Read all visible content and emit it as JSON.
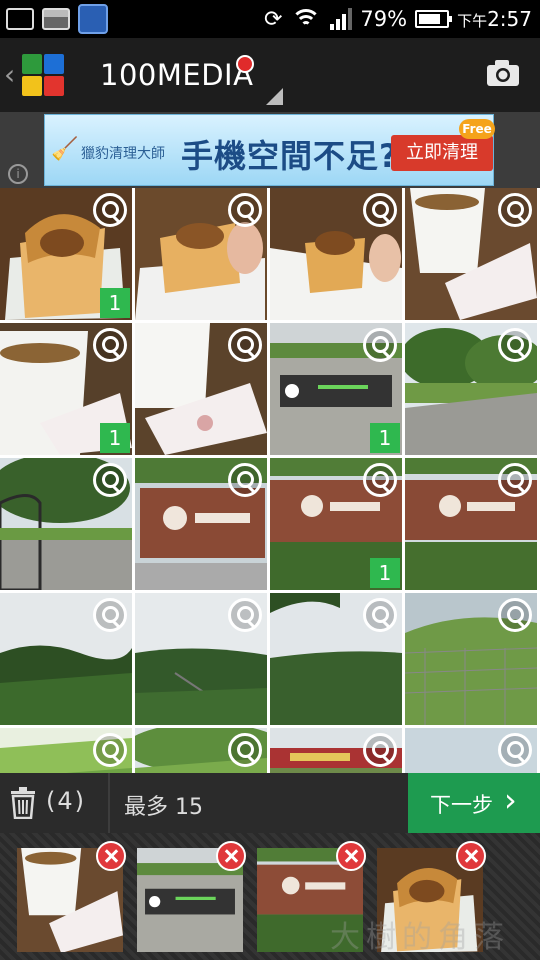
{
  "status_bar": {
    "battery": "79%",
    "time_prefix": "下午",
    "time": "2:57",
    "icons": [
      "edit-icon",
      "image-icon",
      "game-icon",
      "sync-icon",
      "wifi-icon",
      "signal-icon",
      "battery-icon"
    ],
    "battery_level": 0.79
  },
  "app_bar": {
    "back_glyph": "‹",
    "title": "100MEDIA",
    "icons": [
      "app-logo-icon",
      "camera-icon",
      "dropdown-icon"
    ]
  },
  "ad": {
    "brand": "獵豹清理大師",
    "headline": "手機空間不足?",
    "cta": "立即清理",
    "badge": "Free",
    "info": "i"
  },
  "grid": {
    "items": [
      {
        "scene": "cake",
        "count": "1"
      },
      {
        "scene": "cake-hand",
        "count": ""
      },
      {
        "scene": "cake-paper",
        "count": ""
      },
      {
        "scene": "cup-pack",
        "count": ""
      },
      {
        "scene": "cup",
        "count": "1"
      },
      {
        "scene": "cup-pack2",
        "count": ""
      },
      {
        "scene": "wall-sign",
        "count": "1"
      },
      {
        "scene": "trees-wall",
        "count": ""
      },
      {
        "scene": "gate",
        "count": ""
      },
      {
        "scene": "brick-sign",
        "count": ""
      },
      {
        "scene": "brick-sign2",
        "count": "1"
      },
      {
        "scene": "brick-sign3",
        "count": ""
      },
      {
        "scene": "forest",
        "count": ""
      },
      {
        "scene": "valley",
        "count": ""
      },
      {
        "scene": "hills",
        "count": ""
      },
      {
        "scene": "fence",
        "count": ""
      },
      {
        "scene": "grass",
        "count": ""
      },
      {
        "scene": "grass2",
        "count": ""
      },
      {
        "scene": "temple",
        "count": ""
      },
      {
        "scene": "sky",
        "count": ""
      }
    ]
  },
  "toolbar": {
    "selected_count": "(4)",
    "max_label": "最多 15",
    "next_label": "下一步",
    "next_glyph": "›"
  },
  "tray": {
    "items": [
      {
        "scene": "cup-pack"
      },
      {
        "scene": "wall-sign"
      },
      {
        "scene": "brick-sign2"
      },
      {
        "scene": "cake"
      }
    ]
  },
  "watermark": "大樹的角落",
  "colors": {
    "accent_green": "#1e9b50",
    "badge_green": "#2fb84f",
    "remove_red": "#e0383b"
  }
}
